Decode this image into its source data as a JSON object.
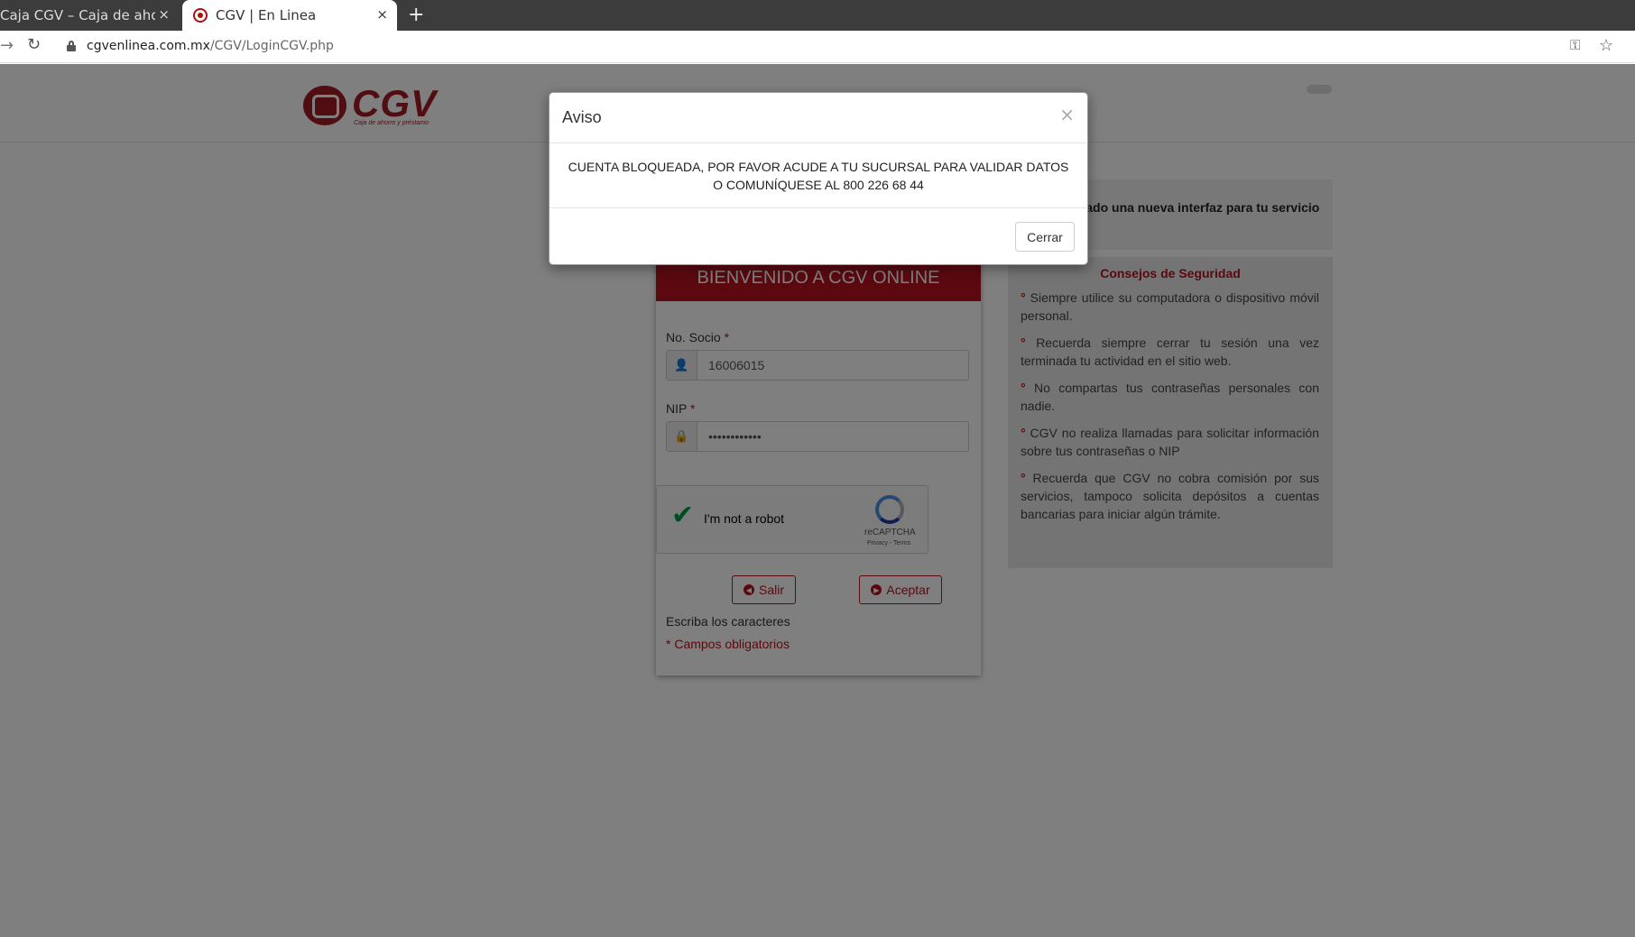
{
  "browser": {
    "tabs": [
      {
        "title": "Caja CGV – Caja de ahorro",
        "active": false
      },
      {
        "title": "CGV | En Linea",
        "active": true
      }
    ],
    "close_glyph": "×",
    "new_tab_glyph": "+",
    "url_host": "cgvenlinea.com.mx",
    "url_path": "/CGV/LoginCGV.php",
    "icons": {
      "forward": "→",
      "reload": "↻",
      "key": "⚿",
      "star": "☆"
    }
  },
  "header": {
    "logo_text": "CGV",
    "logo_subtitle": "Caja de ahorro y préstamo"
  },
  "login": {
    "title": "BIENVENIDO A CGV ONLINE",
    "socio_label": "No. Socio",
    "socio_value": "16006015",
    "nip_label": "NIP",
    "nip_value": "••••••••••••",
    "required_mark": "*",
    "captcha_label": "I'm not a robot",
    "captcha_brand": "reCAPTCHA",
    "captcha_links": "Privacy - Terms",
    "salir_label": "Salir",
    "aceptar_label": "Aceptar",
    "note_chars": "Escriba los caracteres",
    "note_required": "* Campos obligatorios",
    "icons": {
      "user": "👤",
      "lock": "🔒",
      "check": "✔",
      "back": "◀",
      "forward": "▶"
    }
  },
  "info": {
    "banner": "Hemos creado una nueva interfaz para tu servicio",
    "tips_title": "Consejos de Seguridad",
    "tips": [
      "Siempre utilice su computadora o dispositivo móvil personal.",
      "Recuerda siempre cerrar tu sesión una vez terminada tu actividad en el sitio web.",
      "No compartas tus contraseñas personales con nadie.",
      "CGV no realiza llamadas para solicitar información sobre tus contraseñas o NIP",
      "Recuerda que CGV no cobra comisión por sus servicios, tampoco solicita depósitos a cuentas bancarias para iniciar algún trámite."
    ],
    "bullet": "°"
  },
  "modal": {
    "title": "Aviso",
    "close_glyph": "×",
    "message_line1": "CUENTA BLOQUEADA, POR FAVOR ACUDE A TU SUCURSAL PARA VALIDAR DATOS",
    "message_line2": "O COMUNÍQUESE AL 800 226 68 44",
    "button": "Cerrar"
  }
}
